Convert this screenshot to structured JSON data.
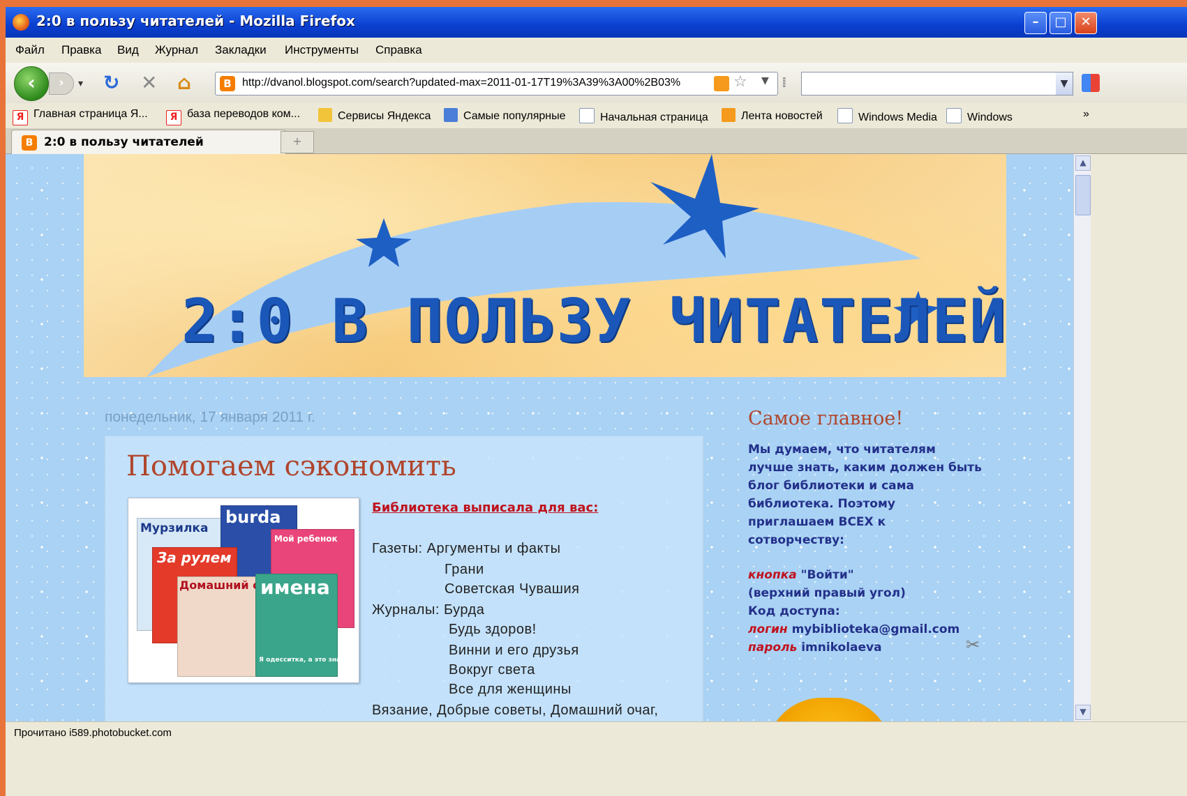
{
  "window": {
    "title": "2:0 в пользу читателей - Mozilla Firefox",
    "buttons": {
      "minimize": "–",
      "maximize": "□",
      "close": "✕"
    }
  },
  "menu": [
    "Файл",
    "Правка",
    "Вид",
    "Журнал",
    "Закладки",
    "Инструменты",
    "Справка"
  ],
  "nav": {
    "back": "‹",
    "forward": "›",
    "reload": "↻",
    "stop": "✕",
    "home": "⌂",
    "url": "http://dvanol.blogspot.com/search?updated-max=2011-01-17T19%3A39%3A00%2B03%",
    "search_value": ""
  },
  "bookmarks": [
    {
      "label": "Главная страница Я...",
      "icon": "yandex-icon",
      "color": "#e22"
    },
    {
      "label": "база переводов ком...",
      "icon": "yandex-icon",
      "color": "#e22"
    },
    {
      "label": "Сервисы Яндекса",
      "icon": "folder-icon",
      "color": "#f2c43a"
    },
    {
      "label": "Самые популярные",
      "icon": "search-icon",
      "color": "#4a7ed8"
    },
    {
      "label": "Начальная страница",
      "icon": "page-icon",
      "color": "#dfe6f2"
    },
    {
      "label": "Лента новостей",
      "icon": "rss-icon",
      "color": "#f59a1c"
    },
    {
      "label": "Windows Media",
      "icon": "page-icon",
      "color": "#dfe6f2"
    },
    {
      "label": "Windows",
      "icon": "page-icon",
      "color": "#dfe6f2"
    }
  ],
  "bookmarks_more": "»",
  "tab": {
    "label": "2:0 в пользу читателей",
    "new_tab": "+"
  },
  "blog": {
    "banner_title": "2:0 В ПОЛЬЗУ ЧИТАТЕЛЕЙ",
    "date": "понедельник, 17 января 2011 г.",
    "post": {
      "title": "Помогаем сэкономить",
      "lead": "Библиотека выписала для вас:",
      "lines": [
        "Газеты:   Аргументы и факты",
        "Грани",
        "Советская Чувашия",
        "Журналы: Бурда",
        "Будь здоров!",
        "Винни и его друзья",
        "Вокруг света",
        "Все для женщины",
        "Вязание, Добрые  советы, Домашний  очаг,"
      ],
      "magazines": [
        "Мурзилка",
        "burda",
        "Мой ребенок",
        "За рулем",
        "Домашний очаг",
        "имена",
        "Я одесситка, а это значит!"
      ]
    },
    "sidebar": {
      "title": "Самое главное!",
      "paragraph": [
        "Мы думаем, что читателям",
        "лучше знать, каким должен быть",
        "блог библиотеки и сама",
        "библиотека. Поэтому",
        "приглашаем ВСЕХ к",
        "сотворчеству:"
      ],
      "button_label": "кнопка",
      "button_value": "\"Войти\"",
      "corner": "(верхний правый угол)",
      "access": "Код доступа:",
      "login_label": "логин",
      "login_value": "mybiblioteka@gmail.com",
      "password_label": "пароль",
      "password_value": "imnikolaeva"
    }
  },
  "status": "Прочитано i589.photobucket.com",
  "colors": {
    "title_bar": "#0a3fd0",
    "accent_red": "#b0452c",
    "link_red": "#c0121e",
    "sidebar_text": "#23308a",
    "page_bg": "#a9d2f4"
  }
}
